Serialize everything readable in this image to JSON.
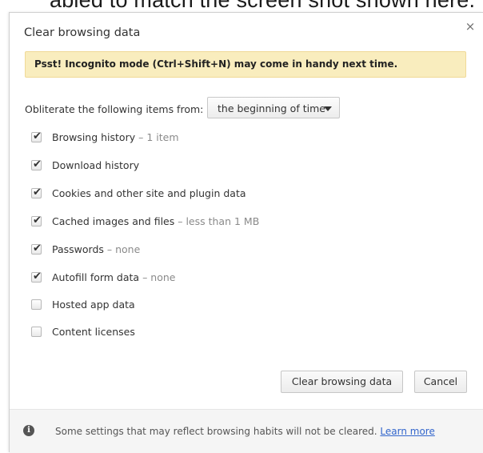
{
  "background": {
    "text": "abled to match the screen shot shown here."
  },
  "dialog": {
    "title": "Clear browsing data",
    "close_symbol": "×",
    "banner": "Psst! Incognito mode (Ctrl+Shift+N) may come in handy next time.",
    "period_label": "Obliterate the following items from:",
    "period_selected": "the beginning of time",
    "items": [
      {
        "label": "Browsing history",
        "detail": " – 1 item",
        "checked": true
      },
      {
        "label": "Download history",
        "detail": "",
        "checked": true
      },
      {
        "label": "Cookies and other site and plugin data",
        "detail": "",
        "checked": true
      },
      {
        "label": "Cached images and files",
        "detail": " – less than 1 MB",
        "checked": true
      },
      {
        "label": "Passwords",
        "detail": " – none",
        "checked": true
      },
      {
        "label": "Autofill form data",
        "detail": " – none",
        "checked": true
      },
      {
        "label": "Hosted app data",
        "detail": "",
        "checked": false
      },
      {
        "label": "Content licenses",
        "detail": "",
        "checked": false
      }
    ],
    "check_symbol": "✔",
    "buttons": {
      "clear": "Clear browsing data",
      "cancel": "Cancel"
    },
    "footer": {
      "text": "Some settings that may reflect browsing habits will not be cleared. ",
      "link": "Learn more",
      "icon_symbol": "i"
    }
  }
}
